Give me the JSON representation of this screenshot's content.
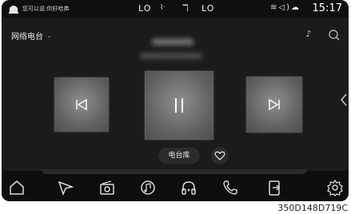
{
  "status_bar": {
    "assistant_hint": "您可以说:你好哈弗",
    "temp_left": "LO",
    "temp_right": "LO",
    "time": "15:17",
    "icons": [
      "assistant-icon",
      "seat-heat-icon",
      "fan-icon",
      "wifi-icon",
      "volume-icon",
      "cloud-icon"
    ]
  },
  "header": {
    "source_label": "网络电台",
    "source_chevron": "⌄"
  },
  "player": {
    "library_label": "电台库"
  },
  "watermark": "350D148D719C"
}
